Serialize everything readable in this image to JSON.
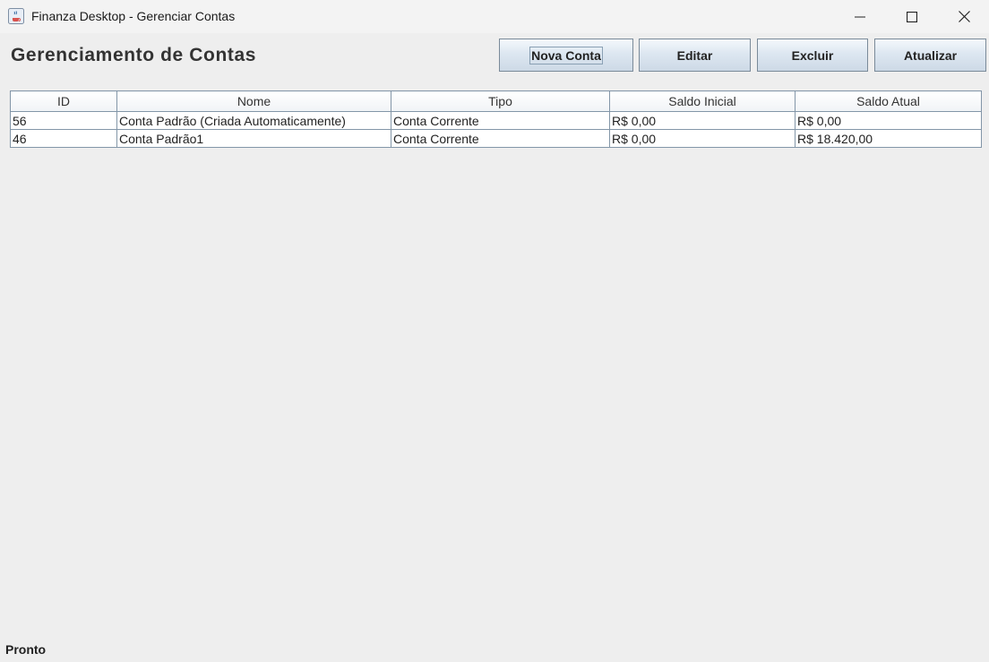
{
  "window": {
    "title": "Finanza Desktop - Gerenciar Contas",
    "icon": "java-cup-icon",
    "controls": [
      "minimize-icon",
      "maximize-icon",
      "close-icon"
    ]
  },
  "header": {
    "title": "Gerenciamento de Contas"
  },
  "toolbar": {
    "new_label": "Nova Conta",
    "edit_label": "Editar",
    "delete_label": "Excluir",
    "refresh_label": "Atualizar"
  },
  "table": {
    "columns": [
      "ID",
      "Nome",
      "Tipo",
      "Saldo Inicial",
      "Saldo Atual"
    ],
    "rows": [
      [
        "56",
        "Conta Padrão (Criada Automaticamente)",
        "Conta Corrente",
        "R$ 0,00",
        "R$ 0,00"
      ],
      [
        "46",
        "Conta Padrão1",
        "Conta Corrente",
        "R$ 0,00",
        "R$ 18.420,00"
      ]
    ]
  },
  "status": {
    "text": "Pronto"
  },
  "colors": {
    "background": "#eeeeee",
    "button_border": "#7a8a99",
    "grid_line": "#8396a8"
  }
}
